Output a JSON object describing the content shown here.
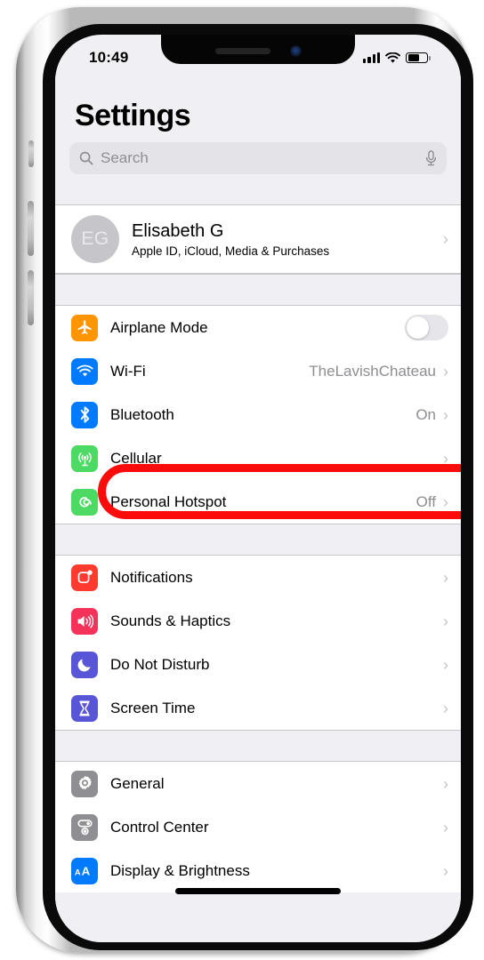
{
  "status_bar": {
    "time": "10:49",
    "signal_icon": "cellular-signal-icon",
    "wifi_icon": "wifi-icon",
    "battery_icon": "battery-icon",
    "battery_level_pct": 62
  },
  "header": {
    "title": "Settings"
  },
  "search": {
    "placeholder": "Search",
    "search_icon": "search-icon",
    "mic_icon": "microphone-icon"
  },
  "apple_id": {
    "initials": "EG",
    "name": "Elisabeth G",
    "subtitle": "Apple ID, iCloud, Media & Purchases",
    "chevron": "›"
  },
  "groups": [
    {
      "id": "connectivity",
      "rows": [
        {
          "icon": "airplane-icon",
          "label": "Airplane Mode",
          "color": "#FF9500",
          "control": "toggle",
          "toggle_on": false
        },
        {
          "icon": "wifi-icon",
          "label": "Wi-Fi",
          "color": "#007AFF",
          "value": "TheLavishChateau",
          "chevron": "›"
        },
        {
          "icon": "bluetooth-icon",
          "label": "Bluetooth",
          "color": "#007AFF",
          "value": "On",
          "chevron": "›",
          "highlighted": true
        },
        {
          "icon": "cellular-icon",
          "label": "Cellular",
          "color": "#4CD964",
          "value": "",
          "chevron": "›"
        },
        {
          "icon": "hotspot-icon",
          "label": "Personal Hotspot",
          "color": "#4CD964",
          "value": "Off",
          "chevron": "›"
        }
      ]
    },
    {
      "id": "alerts",
      "rows": [
        {
          "icon": "notifications-icon",
          "label": "Notifications",
          "color": "#FF3B30",
          "value": "",
          "chevron": "›"
        },
        {
          "icon": "sounds-icon",
          "label": "Sounds & Haptics",
          "color": "#F4325A",
          "value": "",
          "chevron": "›"
        },
        {
          "icon": "moon-icon",
          "label": "Do Not Disturb",
          "color": "#5856D6",
          "value": "",
          "chevron": "›"
        },
        {
          "icon": "hourglass-icon",
          "label": "Screen Time",
          "color": "#5856D6",
          "value": "",
          "chevron": "›"
        }
      ]
    },
    {
      "id": "system",
      "rows": [
        {
          "icon": "gear-icon",
          "label": "General",
          "color": "#8E8E93",
          "value": "",
          "chevron": "›"
        },
        {
          "icon": "control-center-icon",
          "label": "Control Center",
          "color": "#8E8E93",
          "value": "",
          "chevron": "›"
        },
        {
          "icon": "display-brightness-icon",
          "label": "Display & Brightness",
          "color": "#007AFF",
          "value": "",
          "chevron": "›"
        }
      ]
    }
  ],
  "annotation": {
    "type": "oval-highlight",
    "target": "Bluetooth",
    "color": "#FB0B09"
  }
}
